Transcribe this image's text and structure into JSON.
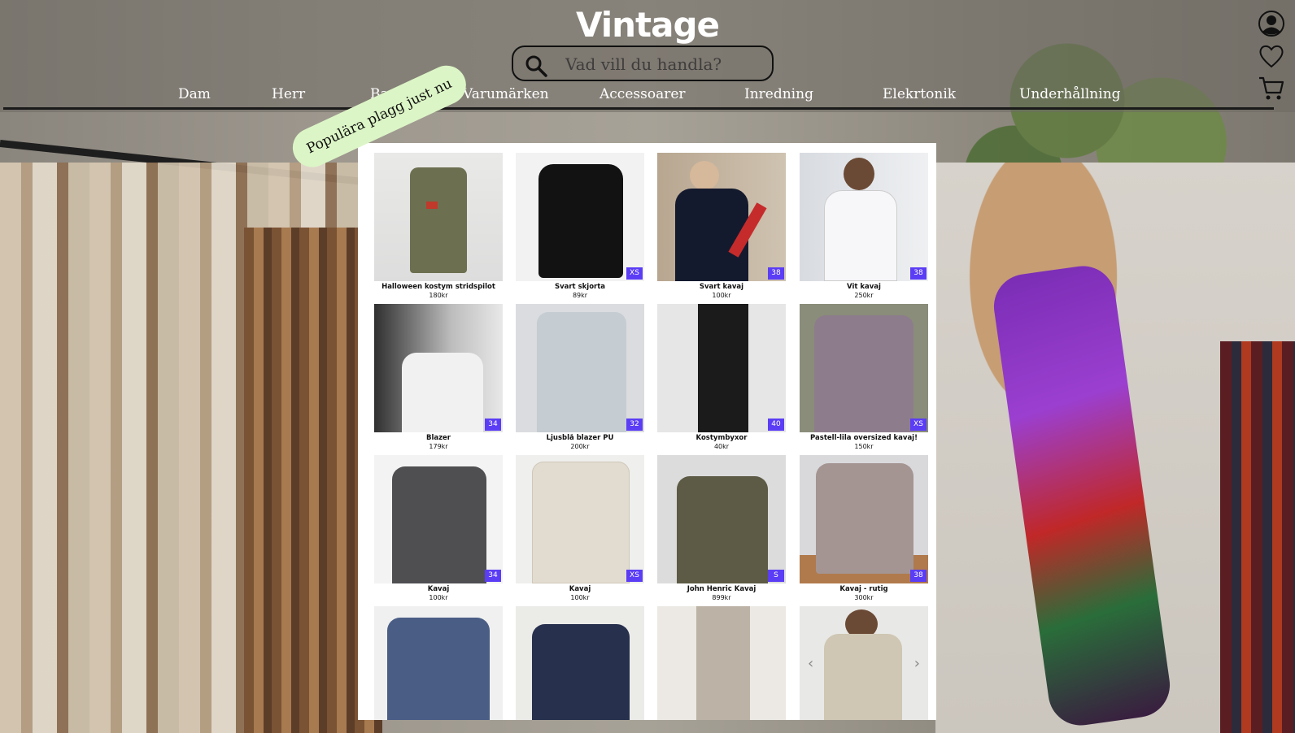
{
  "brand": {
    "title": "Vintage"
  },
  "search": {
    "placeholder": "Vad vill du handla?"
  },
  "nav": {
    "items": [
      {
        "label": "Dam"
      },
      {
        "label": "Herr"
      },
      {
        "label": "Barn"
      },
      {
        "label": "Varumärken"
      },
      {
        "label": "Accessoarer"
      },
      {
        "label": "Inredning"
      },
      {
        "label": "Elekrtonik"
      },
      {
        "label": "Underhållning"
      }
    ]
  },
  "icons": {
    "account": "user-icon",
    "wishlist": "heart-icon",
    "cart": "cart-icon"
  },
  "badge": {
    "label": "Populära plagg just nu"
  },
  "colors": {
    "accent_badge": "#dcf5c6",
    "size_tag": "#5b3df5",
    "nav_text": "#ffffff"
  },
  "products": [
    {
      "title": "Halloween kostym stridspilot",
      "price": "180kr",
      "size": ""
    },
    {
      "title": "Svart skjorta",
      "price": "89kr",
      "size": "XS"
    },
    {
      "title": "Svart kavaj",
      "price": "100kr",
      "size": "38"
    },
    {
      "title": "Vit kavaj",
      "price": "250kr",
      "size": "38"
    },
    {
      "title": "Blazer",
      "price": "179kr",
      "size": "34"
    },
    {
      "title": "Ljusblå blazer PU",
      "price": "200kr",
      "size": "32"
    },
    {
      "title": "Kostymbyxor",
      "price": "40kr",
      "size": "40"
    },
    {
      "title": "Pastell-lila oversized kavaj!",
      "price": "150kr",
      "size": "XS"
    },
    {
      "title": "Kavaj",
      "price": "100kr",
      "size": "34"
    },
    {
      "title": "Kavaj",
      "price": "100kr",
      "size": "XS"
    },
    {
      "title": "John Henric Kavaj",
      "price": "899kr",
      "size": "S"
    },
    {
      "title": "Kavaj - rutig",
      "price": "300kr",
      "size": "38"
    },
    {
      "title": "",
      "price": "",
      "size": ""
    },
    {
      "title": "",
      "price": "",
      "size": ""
    },
    {
      "title": "",
      "price": "",
      "size": ""
    },
    {
      "title": "",
      "price": "",
      "size": ""
    }
  ]
}
